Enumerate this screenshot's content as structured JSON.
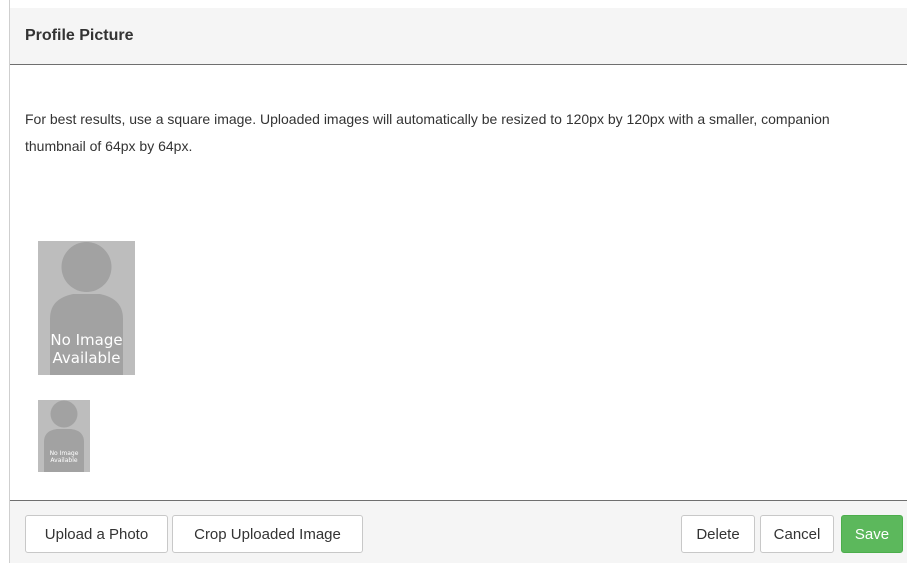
{
  "modal": {
    "title": "Profile Picture",
    "help_text": "For best results, use a square image. Uploaded images will automatically be resized to 120px by 120px with a smaller, companion thumbnail of 64px by 64px.",
    "placeholder_large": {
      "line1": "No Image",
      "line2": "Available"
    },
    "placeholder_small": {
      "line1": "No Image",
      "line2": "Available"
    }
  },
  "footer": {
    "upload_label": "Upload a Photo",
    "crop_label": "Crop Uploaded Image",
    "delete_label": "Delete",
    "cancel_label": "Cancel",
    "save_label": "Save"
  },
  "colors": {
    "save_button": "#5cb85c",
    "placeholder_bg": "#bdbdbd",
    "silhouette": "#a2a2a2"
  },
  "icons": {
    "placeholder_figure": "person-silhouette-icon"
  }
}
